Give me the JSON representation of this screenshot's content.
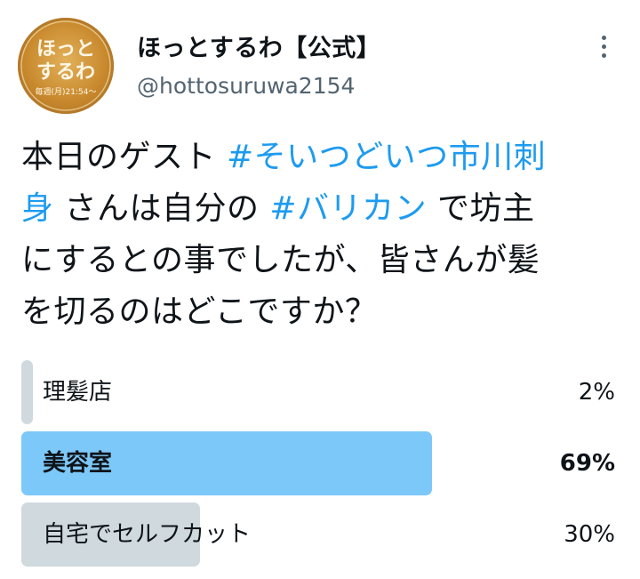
{
  "colors": {
    "hashtag": "#1d9bf0",
    "winner_bar": "#7cc8f8",
    "bar": "#cfd9de",
    "avatar": "#c98a2e"
  },
  "avatar": {
    "line1": "ほっと",
    "line2": "するわ",
    "line3": "毎週(月)21:54〜"
  },
  "header": {
    "display_name": "ほっとするわ【公式】",
    "handle": "@hottosuruwa2154",
    "more_icon": "more-vertical-icon"
  },
  "tweet": {
    "l1a": "本日のゲスト ",
    "l1b": "#そいつどいつ市川刺",
    "l2a": "身",
    "l2b": " さんは自分の ",
    "l2c": "#バリカン",
    "l2d": " で坊主",
    "l3": "にするとの事でしたが、皆さんが髪",
    "l4": "を切るのはどこですか？"
  },
  "poll": {
    "options": [
      {
        "label": "理髪店",
        "percent_text": "2%",
        "percent": 2,
        "winner": false
      },
      {
        "label": "美容室",
        "percent_text": "69%",
        "percent": 69,
        "winner": true
      },
      {
        "label": "自宅でセルフカット",
        "percent_text": "30%",
        "percent": 30,
        "winner": false
      }
    ]
  }
}
